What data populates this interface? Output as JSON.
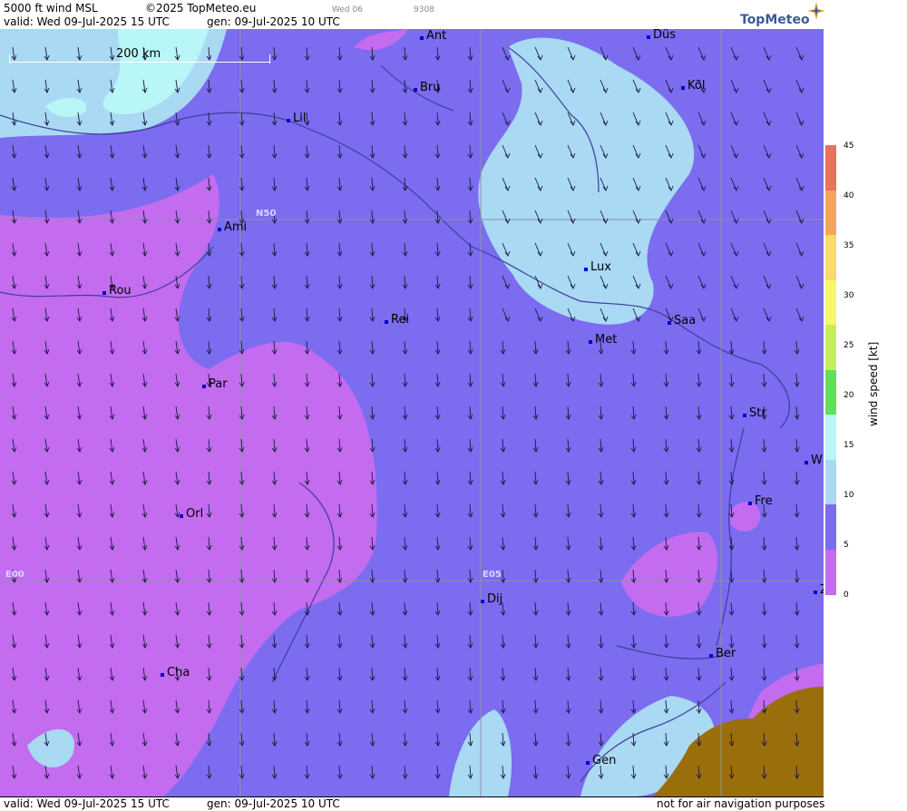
{
  "header": {
    "product": "5000 ft wind MSL",
    "copyright": "©2025 TopMeteo.eu",
    "small_day": "Wed 06",
    "small_code": "9308",
    "valid_line": "valid:  Wed  09-Jul-2025  15 UTC",
    "gen_line": "gen: 09-Jul-2025 10 UTC"
  },
  "logo": {
    "text": "TopMeteo",
    "icon": "compass-star-icon"
  },
  "scale": {
    "label": "200 km"
  },
  "grid_labels": {
    "n50": "N50",
    "e00": "E00",
    "e05": "E05"
  },
  "cities": [
    {
      "name": "Ant"
    },
    {
      "name": "Düs"
    },
    {
      "name": "Bru"
    },
    {
      "name": "Köl"
    },
    {
      "name": "Lil"
    },
    {
      "name": "Ami"
    },
    {
      "name": "Rou"
    },
    {
      "name": "Lux"
    },
    {
      "name": "Rei"
    },
    {
      "name": "Saa"
    },
    {
      "name": "Met"
    },
    {
      "name": "Par"
    },
    {
      "name": "Str"
    },
    {
      "name": "W"
    },
    {
      "name": "Fre"
    },
    {
      "name": "Orl"
    },
    {
      "name": "Dij"
    },
    {
      "name": "Ber"
    },
    {
      "name": "Cha"
    },
    {
      "name": "Gen"
    },
    {
      "name": "Z"
    }
  ],
  "legend": {
    "title": "wind speed [kt]",
    "ticks": [
      "45",
      "40",
      "35",
      "30",
      "25",
      "20",
      "15",
      "10",
      "5",
      "0"
    ],
    "colors": [
      "#e8725a",
      "#f3a65b",
      "#fbd96b",
      "#f6f76a",
      "#c4ef5a",
      "#5fe05a",
      "#b8f6f7",
      "#a9d9f3",
      "#7c6cf0",
      "#c36cf0"
    ]
  },
  "map_colors": {
    "calm": "#c36cf0",
    "light": "#7c6cf0",
    "moderate": "#a9d9f3",
    "fresh": "#b8f6f7",
    "terrain": "#9a6e0a",
    "border": "#3e3e9a",
    "grid": "#9090a8"
  },
  "footer": {
    "valid_line": "valid:  Wed  09-Jul-2025  15 UTC",
    "gen_line": "gen: 09-Jul-2025 10 UTC",
    "disclaimer": "not for air navigation purposes"
  }
}
